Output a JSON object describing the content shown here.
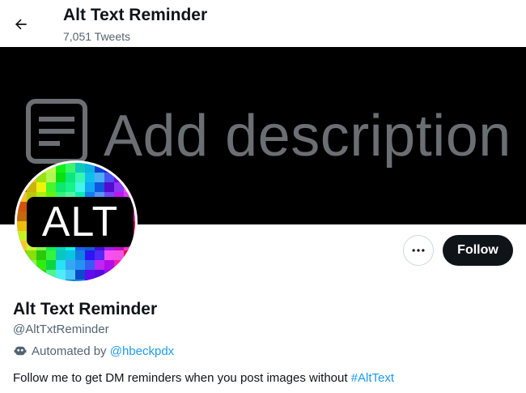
{
  "header": {
    "back_icon": "arrow-left-icon",
    "title": "Alt Text Reminder",
    "tweet_count": "7,051 Tweets"
  },
  "banner": {
    "icon": "document-lines-icon",
    "text": "Add description"
  },
  "avatar": {
    "badge_text": "ALT"
  },
  "actions": {
    "more_icon": "more-horizontal-icon",
    "follow_label": "Follow"
  },
  "profile": {
    "display_name": "Alt Text Reminder",
    "handle": "@AltTxtReminder",
    "automated_icon": "robot-icon",
    "automated_prefix": "Automated by ",
    "automated_by": "@hbeckpdx",
    "bio_text": "Follow me to get DM reminders when you post images without ",
    "bio_hashtag": "#AltText"
  },
  "colors": {
    "accent": "#1d9bf0",
    "text_primary": "#0f1419",
    "text_secondary": "#536471",
    "follow_bg": "#0f1419",
    "banner_bg": "#000000",
    "banner_text": "#6b6f73"
  }
}
